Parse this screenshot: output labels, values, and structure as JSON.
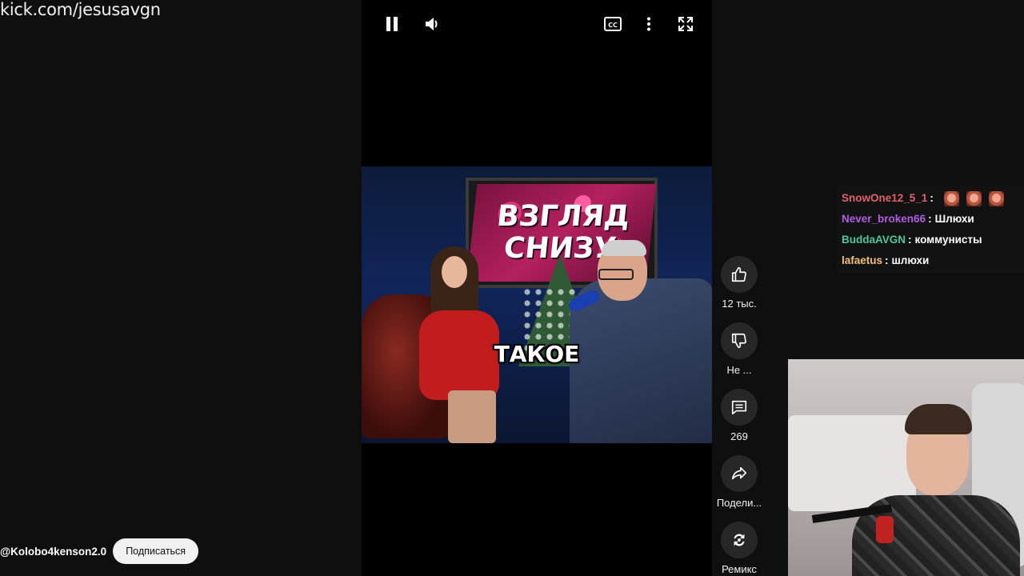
{
  "overlay": {
    "url": "kick.com/jesusavgn"
  },
  "video": {
    "caption": "ТАКОЕ",
    "show_title_line1": "ВЗГЛЯД",
    "show_title_line2": "СНИЗУ"
  },
  "actions": [
    {
      "icon": "thumbs-up-icon",
      "label": "12 тыс."
    },
    {
      "icon": "thumbs-down-icon",
      "label": "Не ..."
    },
    {
      "icon": "comment-icon",
      "label": "269"
    },
    {
      "icon": "share-icon",
      "label": "Подели..."
    },
    {
      "icon": "remix-icon",
      "label": "Ремикс"
    }
  ],
  "chat": {
    "messages": [
      {
        "user": "SnowOne12_5_1",
        "color": "#e06070",
        "text": "",
        "emotes": 3
      },
      {
        "user": "Never_broken66",
        "color": "#b15de0",
        "text": "Шлюхи",
        "emotes": 0
      },
      {
        "user": "BuddaAVGN",
        "color": "#4fc79c",
        "text": "коммунисты",
        "emotes": 0
      },
      {
        "user": "lafaetus",
        "color": "#f0c080",
        "text": "шлюхи",
        "emotes": 0
      }
    ]
  },
  "channel": {
    "handle": "@Kolobo4kenson2.0",
    "subscribe_label": "Подписаться"
  }
}
